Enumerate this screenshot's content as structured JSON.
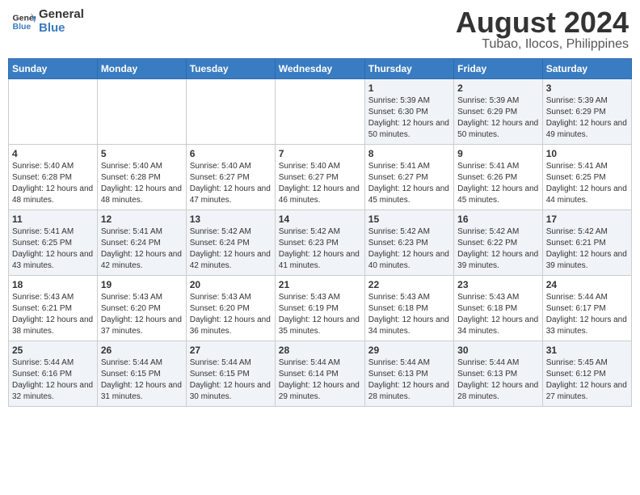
{
  "header": {
    "logo_line1": "General",
    "logo_line2": "Blue",
    "title": "August 2024",
    "subtitle": "Tubao, Ilocos, Philippines"
  },
  "days_of_week": [
    "Sunday",
    "Monday",
    "Tuesday",
    "Wednesday",
    "Thursday",
    "Friday",
    "Saturday"
  ],
  "weeks": [
    [
      {
        "num": "",
        "info": ""
      },
      {
        "num": "",
        "info": ""
      },
      {
        "num": "",
        "info": ""
      },
      {
        "num": "",
        "info": ""
      },
      {
        "num": "1",
        "info": "Sunrise: 5:39 AM\nSunset: 6:30 PM\nDaylight: 12 hours and 50 minutes."
      },
      {
        "num": "2",
        "info": "Sunrise: 5:39 AM\nSunset: 6:29 PM\nDaylight: 12 hours and 50 minutes."
      },
      {
        "num": "3",
        "info": "Sunrise: 5:39 AM\nSunset: 6:29 PM\nDaylight: 12 hours and 49 minutes."
      }
    ],
    [
      {
        "num": "4",
        "info": "Sunrise: 5:40 AM\nSunset: 6:28 PM\nDaylight: 12 hours and 48 minutes."
      },
      {
        "num": "5",
        "info": "Sunrise: 5:40 AM\nSunset: 6:28 PM\nDaylight: 12 hours and 48 minutes."
      },
      {
        "num": "6",
        "info": "Sunrise: 5:40 AM\nSunset: 6:27 PM\nDaylight: 12 hours and 47 minutes."
      },
      {
        "num": "7",
        "info": "Sunrise: 5:40 AM\nSunset: 6:27 PM\nDaylight: 12 hours and 46 minutes."
      },
      {
        "num": "8",
        "info": "Sunrise: 5:41 AM\nSunset: 6:27 PM\nDaylight: 12 hours and 45 minutes."
      },
      {
        "num": "9",
        "info": "Sunrise: 5:41 AM\nSunset: 6:26 PM\nDaylight: 12 hours and 45 minutes."
      },
      {
        "num": "10",
        "info": "Sunrise: 5:41 AM\nSunset: 6:25 PM\nDaylight: 12 hours and 44 minutes."
      }
    ],
    [
      {
        "num": "11",
        "info": "Sunrise: 5:41 AM\nSunset: 6:25 PM\nDaylight: 12 hours and 43 minutes."
      },
      {
        "num": "12",
        "info": "Sunrise: 5:41 AM\nSunset: 6:24 PM\nDaylight: 12 hours and 42 minutes."
      },
      {
        "num": "13",
        "info": "Sunrise: 5:42 AM\nSunset: 6:24 PM\nDaylight: 12 hours and 42 minutes."
      },
      {
        "num": "14",
        "info": "Sunrise: 5:42 AM\nSunset: 6:23 PM\nDaylight: 12 hours and 41 minutes."
      },
      {
        "num": "15",
        "info": "Sunrise: 5:42 AM\nSunset: 6:23 PM\nDaylight: 12 hours and 40 minutes."
      },
      {
        "num": "16",
        "info": "Sunrise: 5:42 AM\nSunset: 6:22 PM\nDaylight: 12 hours and 39 minutes."
      },
      {
        "num": "17",
        "info": "Sunrise: 5:42 AM\nSunset: 6:21 PM\nDaylight: 12 hours and 39 minutes."
      }
    ],
    [
      {
        "num": "18",
        "info": "Sunrise: 5:43 AM\nSunset: 6:21 PM\nDaylight: 12 hours and 38 minutes."
      },
      {
        "num": "19",
        "info": "Sunrise: 5:43 AM\nSunset: 6:20 PM\nDaylight: 12 hours and 37 minutes."
      },
      {
        "num": "20",
        "info": "Sunrise: 5:43 AM\nSunset: 6:20 PM\nDaylight: 12 hours and 36 minutes."
      },
      {
        "num": "21",
        "info": "Sunrise: 5:43 AM\nSunset: 6:19 PM\nDaylight: 12 hours and 35 minutes."
      },
      {
        "num": "22",
        "info": "Sunrise: 5:43 AM\nSunset: 6:18 PM\nDaylight: 12 hours and 34 minutes."
      },
      {
        "num": "23",
        "info": "Sunrise: 5:43 AM\nSunset: 6:18 PM\nDaylight: 12 hours and 34 minutes."
      },
      {
        "num": "24",
        "info": "Sunrise: 5:44 AM\nSunset: 6:17 PM\nDaylight: 12 hours and 33 minutes."
      }
    ],
    [
      {
        "num": "25",
        "info": "Sunrise: 5:44 AM\nSunset: 6:16 PM\nDaylight: 12 hours and 32 minutes."
      },
      {
        "num": "26",
        "info": "Sunrise: 5:44 AM\nSunset: 6:15 PM\nDaylight: 12 hours and 31 minutes."
      },
      {
        "num": "27",
        "info": "Sunrise: 5:44 AM\nSunset: 6:15 PM\nDaylight: 12 hours and 30 minutes."
      },
      {
        "num": "28",
        "info": "Sunrise: 5:44 AM\nSunset: 6:14 PM\nDaylight: 12 hours and 29 minutes."
      },
      {
        "num": "29",
        "info": "Sunrise: 5:44 AM\nSunset: 6:13 PM\nDaylight: 12 hours and 28 minutes."
      },
      {
        "num": "30",
        "info": "Sunrise: 5:44 AM\nSunset: 6:13 PM\nDaylight: 12 hours and 28 minutes."
      },
      {
        "num": "31",
        "info": "Sunrise: 5:45 AM\nSunset: 6:12 PM\nDaylight: 12 hours and 27 minutes."
      }
    ]
  ]
}
